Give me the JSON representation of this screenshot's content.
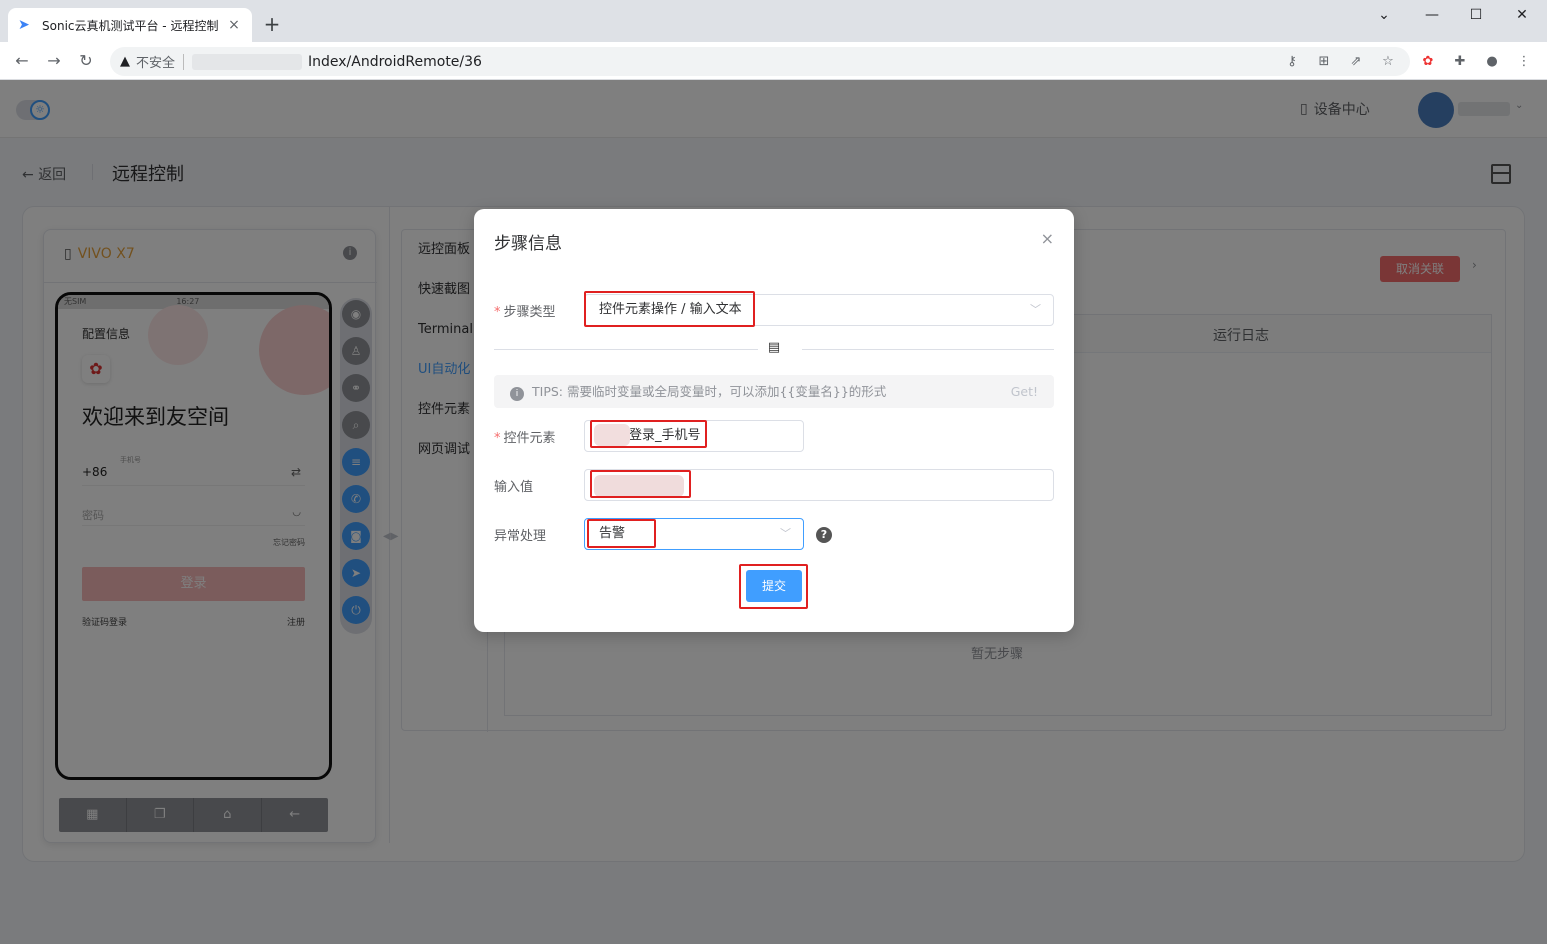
{
  "browser": {
    "tab_title": "Sonic云真机测试平台 - 远程控制",
    "tab_close": "×",
    "new_tab": "+",
    "insecure_label": "不安全",
    "url": "Index/AndroidRemote/36"
  },
  "header": {
    "device_center": "设备中心"
  },
  "page": {
    "back_label": "返回",
    "title": "远程控制"
  },
  "device": {
    "name": "VIVO X7",
    "status_bar": "无SIM",
    "time": "16:27",
    "screen": {
      "config": "配置信息",
      "welcome": "欢迎来到友空间",
      "phone_label": "手机号",
      "phone_prefix": "+86",
      "password": "密码",
      "forgot": "忘记密码",
      "login": "登录",
      "sms_login": "验证码登录",
      "register": "注册"
    }
  },
  "side_tabs": [
    "远控面板",
    "快速截图",
    "Terminal",
    "UI自动化",
    "控件元素",
    "网页调试"
  ],
  "right": {
    "unlink": "取消关联",
    "log_column": "运行日志",
    "empty_steps": "暂无步骤"
  },
  "dialog": {
    "title": "步骤信息",
    "close": "×",
    "step_type_label": "步骤类型",
    "step_type_value": "控件元素操作 / 输入文本",
    "tips": "TIPS: 需要临时变量或全局变量时，可以添加{{变量名}}的形式",
    "tips_get": "Get!",
    "element_label": "控件元素",
    "element_value": "登录_手机号",
    "input_label": "输入值",
    "error_label": "异常处理",
    "error_value": "告警",
    "submit": "提交"
  },
  "colors": {
    "primary": "#409eff",
    "danger": "#f56c6c",
    "annotation": "#e02020",
    "device_name": "#e6a23c"
  }
}
